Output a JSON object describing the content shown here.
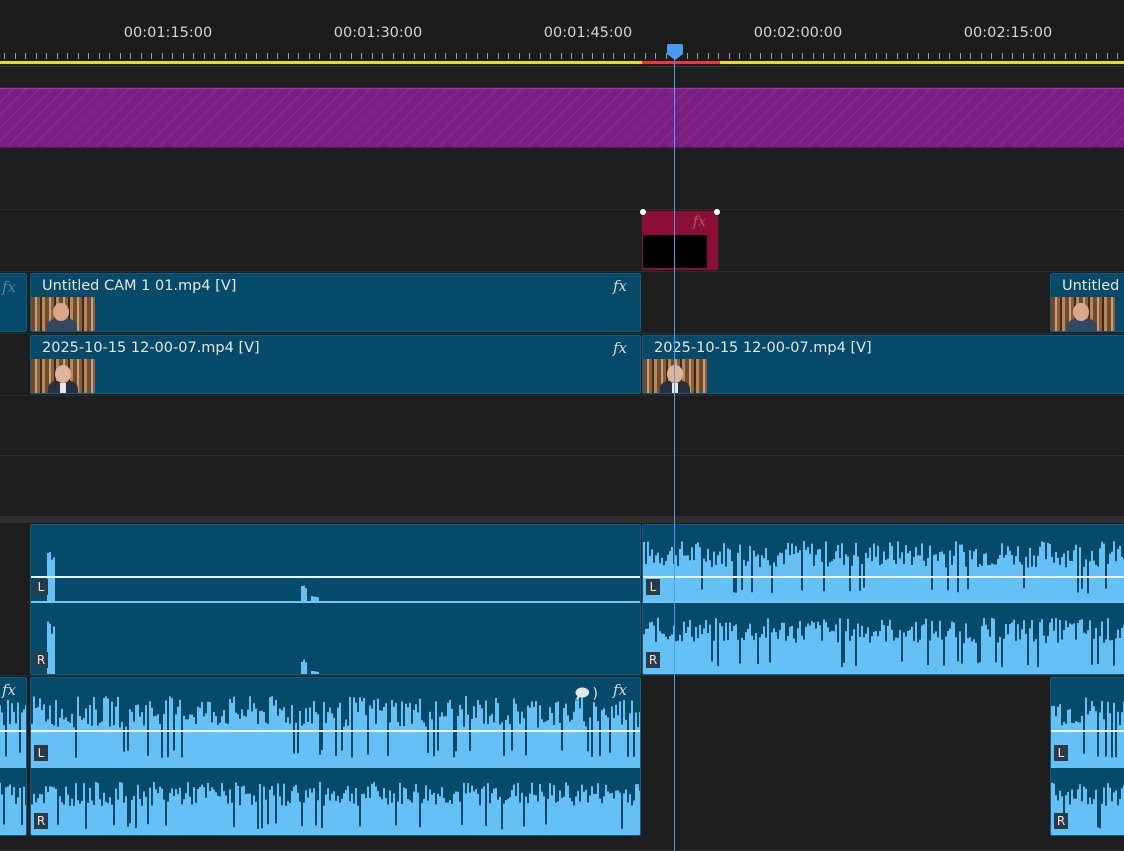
{
  "ruler": {
    "timecodes": [
      "00:01:15:00",
      "00:01:30:00",
      "00:01:45:00",
      "00:02:00:00",
      "00:02:15:00"
    ]
  },
  "video_clips": {
    "v3_clip": {
      "fx": "fx"
    },
    "v2_left": {
      "name": "Untitled CAM 1 01.mp4 [V]",
      "fx": "fx"
    },
    "v2_left_stub": {
      "fx": "fx"
    },
    "v2_right": {
      "name": "Untitled C"
    },
    "v1_left": {
      "name": "2025-10-15 12-00-07.mp4 [V]",
      "fx": "fx"
    },
    "v1_right": {
      "name": "2025-10-15 12-00-07.mp4 [V]"
    }
  },
  "audio": {
    "channel_left": "L",
    "channel_right": "R",
    "a2_fx": "fx",
    "a2_stub_fx": "fx"
  },
  "colors": {
    "playhead": "#4a9cf0",
    "clip_blue": "#054a69",
    "waveform": "#64c0f5",
    "adjustment_purple": "#7a1f82",
    "graphic_red": "#8a0e35",
    "work_area": "#e8e000"
  }
}
